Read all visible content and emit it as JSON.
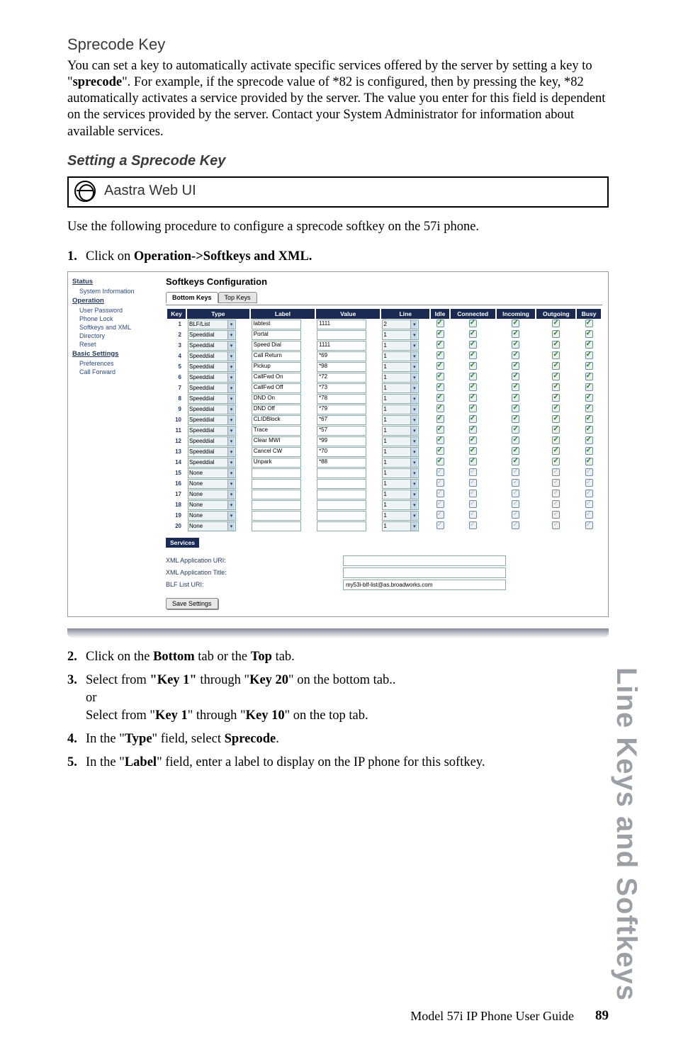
{
  "headings": {
    "h2": "Sprecode Key",
    "h3": "Setting a Sprecode Key"
  },
  "paragraphs": {
    "intro": "You can set a key to automatically activate specific services offered by the server by setting a key to \"sprecode\". For example, if the sprecode value of *82 is configured, then by pressing the key, *82 automatically activates a service provided by the server. The value you enter for this field is dependent on the services provided by the server. Contact your System Administrator for information about available services.",
    "use_procedure": "Use the following procedure to configure a sprecode softkey on the 57i phone."
  },
  "webui_label": "Aastra Web UI",
  "steps": {
    "s1_pre": "Click on ",
    "s1_bold": "Operation->Softkeys and XML.",
    "s2_a": "Click on the ",
    "s2_b": "Bottom",
    "s2_c": " tab or the ",
    "s2_d": "Top",
    "s2_e": " tab.",
    "s3_a": "Select from ",
    "s3_b": "\"Key 1\"",
    "s3_c": " through \"",
    "s3_d": "Key 20",
    "s3_e": "\" on the bottom tab..",
    "s3_or": "or",
    "s3_f": "Select from \"",
    "s3_g": "Key 1",
    "s3_h": "\" through \"",
    "s3_i": "Key 10",
    "s3_j": "\" on the top tab.",
    "s4_a": "In the \"",
    "s4_b": "Type",
    "s4_c": "\" field, select ",
    "s4_d": "Sprecode",
    "s4_e": ".",
    "s5_a": "In the \"",
    "s5_b": "Label",
    "s5_c": "\" field, enter a label to display on the IP phone for this softkey."
  },
  "screenshot": {
    "nav": {
      "status": "Status",
      "sysinfo": "System Information",
      "operation": "Operation",
      "userpw": "User Password",
      "phonelock": "Phone Lock",
      "softkeys": "Softkeys and XML",
      "directory": "Directory",
      "reset": "Reset",
      "basic": "Basic Settings",
      "prefs": "Preferences",
      "callfwd": "Call Forward"
    },
    "title": "Softkeys Configuration",
    "tabs": {
      "bottom": "Bottom Keys",
      "top": "Top Keys"
    },
    "headers": {
      "key": "Key",
      "type": "Type",
      "label": "Label",
      "value": "Value",
      "line": "Line",
      "idle": "Idle",
      "connected": "Connected",
      "incoming": "Incoming",
      "outgoing": "Outgoing",
      "busy": "Busy"
    },
    "rows": [
      {
        "key": "1",
        "type": "BLF/List",
        "label": "labtest",
        "value": "1111",
        "line": "2",
        "on": true
      },
      {
        "key": "2",
        "type": "Speeddial",
        "label": "Portal",
        "value": "",
        "line": "1",
        "on": true
      },
      {
        "key": "3",
        "type": "Speeddial",
        "label": "Speed Dial",
        "value": "1111",
        "line": "1",
        "on": true
      },
      {
        "key": "4",
        "type": "Speeddial",
        "label": "Call Return",
        "value": "*69",
        "line": "1",
        "on": true
      },
      {
        "key": "5",
        "type": "Speeddial",
        "label": "Pickup",
        "value": "*98",
        "line": "1",
        "on": true
      },
      {
        "key": "6",
        "type": "Speeddial",
        "label": "CallFwd On",
        "value": "*72",
        "line": "1",
        "on": true
      },
      {
        "key": "7",
        "type": "Speeddial",
        "label": "CallFwd Off",
        "value": "*73",
        "line": "1",
        "on": true
      },
      {
        "key": "8",
        "type": "Speeddial",
        "label": "DND On",
        "value": "*78",
        "line": "1",
        "on": true
      },
      {
        "key": "9",
        "type": "Speeddial",
        "label": "DND Off",
        "value": "*79",
        "line": "1",
        "on": true
      },
      {
        "key": "10",
        "type": "Speeddial",
        "label": "CLIDBlock",
        "value": "*67",
        "line": "1",
        "on": true
      },
      {
        "key": "11",
        "type": "Speeddial",
        "label": "Trace",
        "value": "*57",
        "line": "1",
        "on": true
      },
      {
        "key": "12",
        "type": "Speeddial",
        "label": "Clear MWI",
        "value": "*99",
        "line": "1",
        "on": true
      },
      {
        "key": "13",
        "type": "Speeddial",
        "label": "Cancel CW",
        "value": "*70",
        "line": "1",
        "on": true
      },
      {
        "key": "14",
        "type": "Speeddial",
        "label": "Unpark",
        "value": "*88",
        "line": "1",
        "on": true
      },
      {
        "key": "15",
        "type": "None",
        "label": "",
        "value": "",
        "line": "1",
        "on": false
      },
      {
        "key": "16",
        "type": "None",
        "label": "",
        "value": "",
        "line": "1",
        "on": false
      },
      {
        "key": "17",
        "type": "None",
        "label": "",
        "value": "",
        "line": "1",
        "on": false
      },
      {
        "key": "18",
        "type": "None",
        "label": "",
        "value": "",
        "line": "1",
        "on": false
      },
      {
        "key": "19",
        "type": "None",
        "label": "",
        "value": "",
        "line": "1",
        "on": false
      },
      {
        "key": "20",
        "type": "None",
        "label": "",
        "value": "",
        "line": "1",
        "on": false
      }
    ],
    "services_head": "Services",
    "services": {
      "xml_uri_label": "XML Application URI:",
      "xml_title_label": "XML Application Title:",
      "blf_label": "BLF List URI:",
      "blf_value": "my53i-blf-list@as.broadworks.com"
    },
    "save": "Save Settings"
  },
  "side_tab": "Line Keys and Softkeys",
  "footer": {
    "guide": "Model 57i IP Phone User Guide",
    "page": "89"
  }
}
